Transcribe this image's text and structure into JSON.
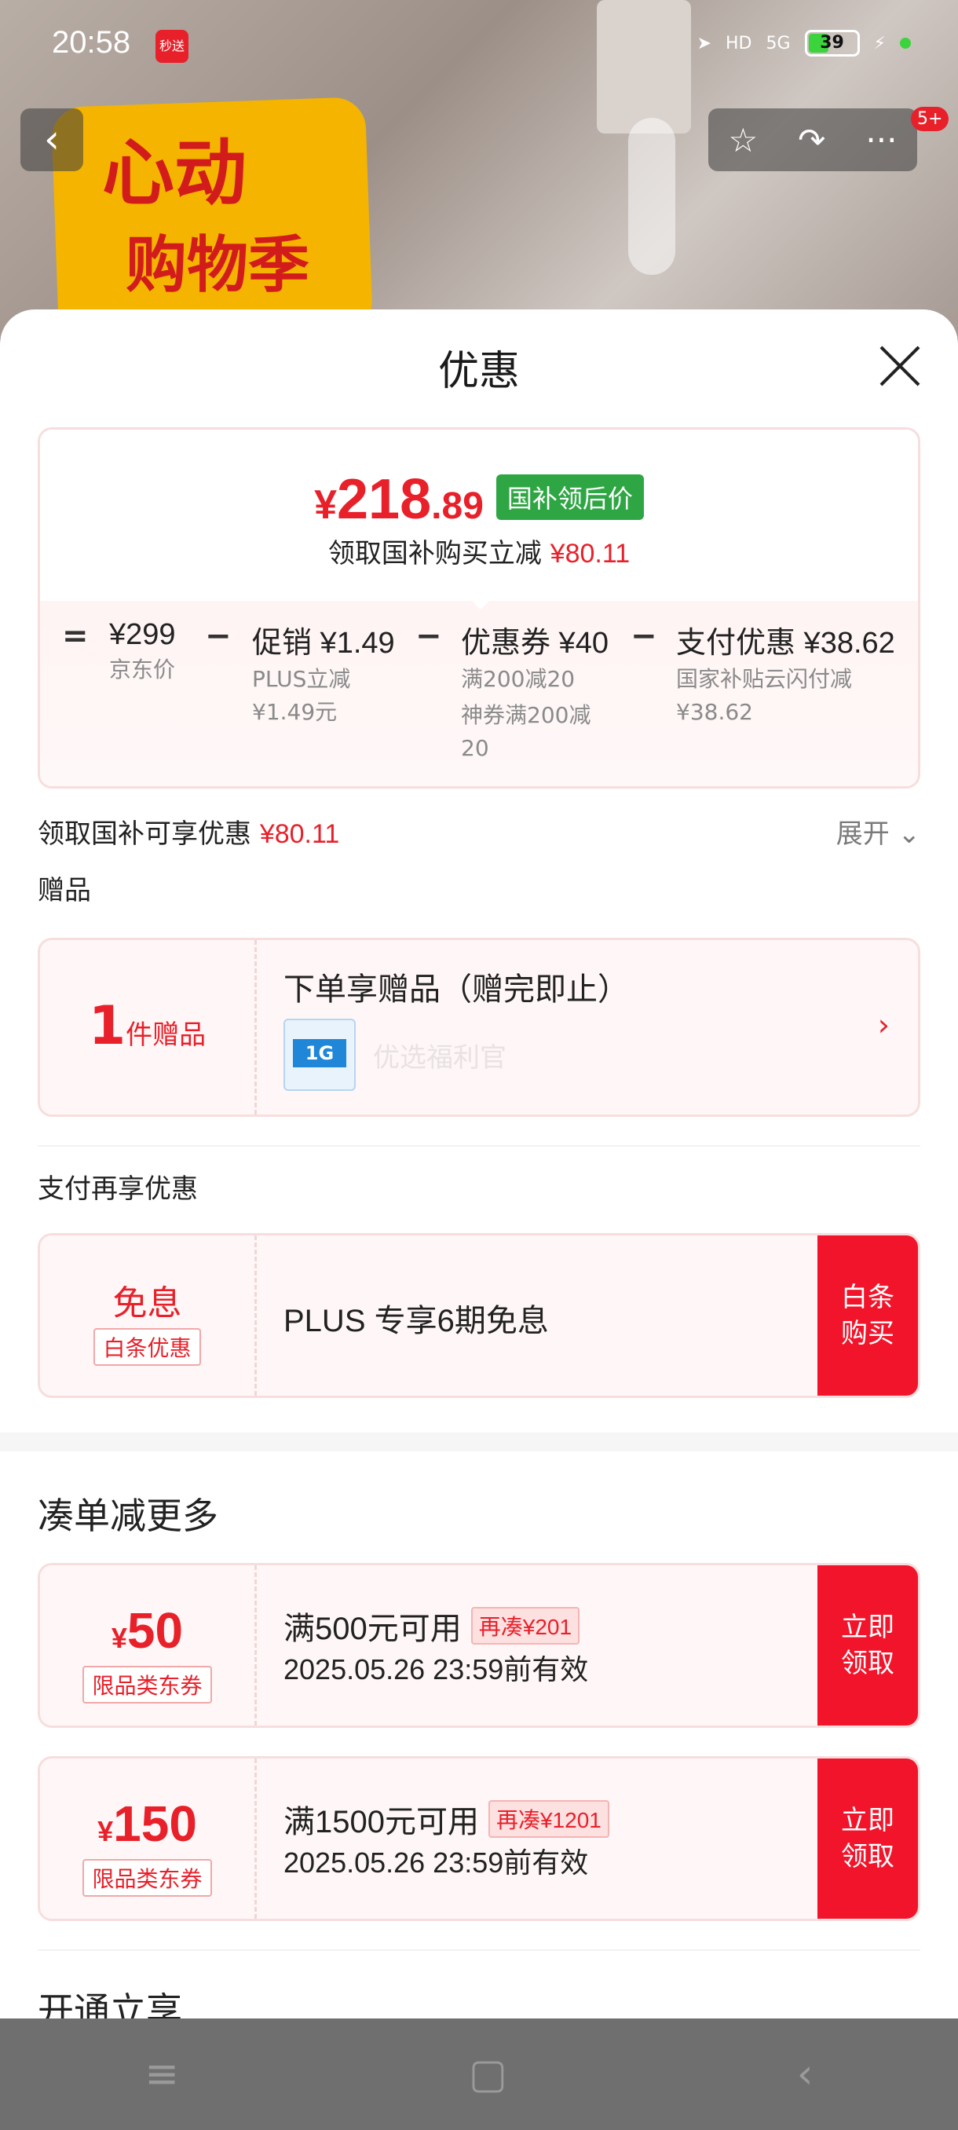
{
  "status_bar": {
    "time": "20:58",
    "app_badge": "秒送",
    "battery": "39",
    "network": "5G",
    "hd": "HD"
  },
  "product_banner": {
    "line1": "心动",
    "line2": "购物季"
  },
  "nav": {
    "back_icon": "‹",
    "favorite_icon": "☆",
    "share_icon": "↷",
    "more_icon": "···",
    "badge": "5+"
  },
  "sheet": {
    "title": "优惠",
    "price_card": {
      "currency": "¥",
      "price_int": "218",
      "price_dec": ".89",
      "tag": "国补领后价",
      "subtitle": "领取国补购买立减",
      "subtitle_amount": "¥80.11",
      "breakdown": [
        {
          "op": "=",
          "head": "¥299",
          "sub": [
            "京东价"
          ]
        },
        {
          "op": "−",
          "head": "促销 ¥1.49",
          "sub": [
            "PLUS立减",
            "¥1.49元"
          ]
        },
        {
          "op": "−",
          "head": "优惠券 ¥40",
          "sub": [
            "满200减20",
            "神券满200减",
            "20"
          ]
        },
        {
          "op": "−",
          "head": "支付优惠 ¥38.62",
          "sub": [
            "国家补贴云闪付减",
            "¥38.62"
          ]
        }
      ]
    },
    "subsidy_row": {
      "label": "领取国补可享优惠",
      "amount": "¥80.11",
      "expand": "展开 ⌄"
    },
    "gift_section": {
      "title": "赠品",
      "count": "1",
      "count_unit": "件赠品",
      "card_title": "下单享赠品（赠完即止）",
      "thumb_text": "1G",
      "item_name": "优选福利官",
      "chevron": "›"
    },
    "pay_section": {
      "title": "支付再享优惠",
      "left_title": "免息",
      "left_tag": "白条优惠",
      "text": "PLUS 专享6期免息",
      "button": "白条\n购买"
    },
    "coupon_section": {
      "title": "凑单减更多",
      "coupons": [
        {
          "sym": "¥",
          "amount": "50",
          "tag": "限品类东券",
          "condition": "满500元可用",
          "extra": "再凑¥201",
          "date": "2025.05.26 23:59前有效",
          "button": "立即\n领取"
        },
        {
          "sym": "¥",
          "amount": "150",
          "tag": "限品类东券",
          "condition": "满1500元可用",
          "extra": "再凑¥1201",
          "date": "2025.05.26 23:59前有效",
          "button": "立即\n领取"
        }
      ]
    },
    "partial_title": "开通立享"
  },
  "system_nav": {
    "menu": "≡",
    "home": "▢",
    "back": "‹"
  },
  "colors": {
    "accent_red": "#e8202a",
    "tag_green": "#2fa644"
  }
}
